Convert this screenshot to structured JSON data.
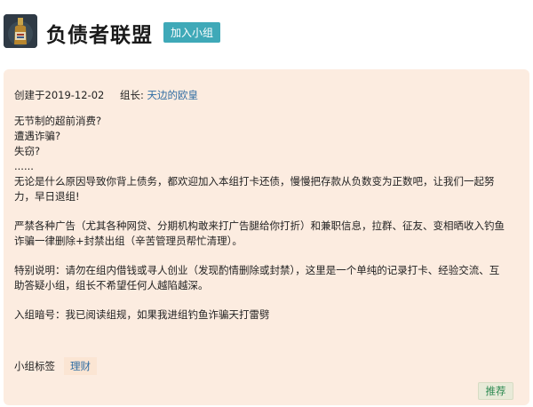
{
  "group": {
    "name": "负债者联盟",
    "join_label": "加入小组"
  },
  "info": {
    "created": "创建于2019-12-02",
    "leader_label": "组长:",
    "leader_name": "天边的欧皇"
  },
  "description": {
    "lines": [
      "无节制的超前消费?",
      "遭遇诈骗?",
      "失窃?",
      "......",
      "无论是什么原因导致你背上债务，都欢迎加入本组打卡还债，慢慢把存款从负数变为正数吧，让我们一起努",
      "力，早日退组!"
    ],
    "rules": [
      "严禁各种广告（尤其各种网贷、分期机构敢来打广告腿给你打折）和兼职信息，拉群、征友、变相晒收入钓鱼",
      "诈骗一律删除+封禁出组（辛苦管理员帮忙清理）。"
    ],
    "special": [
      "特别说明：请勿在组内借钱或寻人创业（发现酌情删除或封禁），这里是一个单纯的记录打卡、经验交流、互",
      "助答疑小组，组长不希望任何人越陷越深。"
    ],
    "password": "入组暗号：我已阅读组规，如果我进组钓鱼诈骗天打雷劈"
  },
  "tags": {
    "label": "小组标签",
    "items": [
      "理财"
    ]
  },
  "recommend_label": "推荐",
  "colors": {
    "card_bg": "#fcece0",
    "join_button": "#3fa9b8",
    "link": "#2f6da3",
    "recommend_text": "#2e8a52"
  }
}
